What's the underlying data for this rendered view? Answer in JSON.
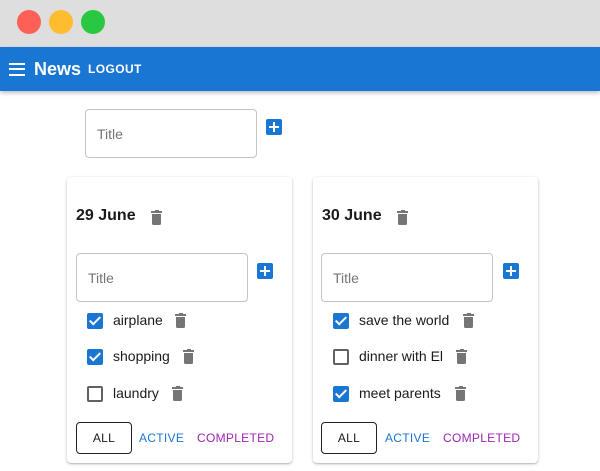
{
  "window": {
    "controls": [
      "close",
      "minimize",
      "maximize"
    ]
  },
  "appbar": {
    "title": "News",
    "logout_label": "LOGOUT",
    "color": "#1976d2"
  },
  "new_list": {
    "placeholder": "Title"
  },
  "lists": [
    {
      "title": "29 June",
      "input_placeholder": "Title",
      "tasks": [
        {
          "label": "airplane",
          "done": true
        },
        {
          "label": "shopping",
          "done": true
        },
        {
          "label": "laundry",
          "done": false
        }
      ],
      "filters": {
        "all": "ALL",
        "active": "ACTIVE",
        "completed": "COMPLETED"
      }
    },
    {
      "title": "30 June",
      "input_placeholder": "Title",
      "tasks": [
        {
          "label": "save the world",
          "done": true
        },
        {
          "label": "dinner with El",
          "done": false
        },
        {
          "label": "meet parents",
          "done": true
        }
      ],
      "filters": {
        "all": "ALL",
        "active": "ACTIVE",
        "completed": "COMPLETED"
      }
    }
  ],
  "colors": {
    "accent": "#1976d2",
    "completed": "#9c27b0",
    "icon_gray": "#757575"
  }
}
